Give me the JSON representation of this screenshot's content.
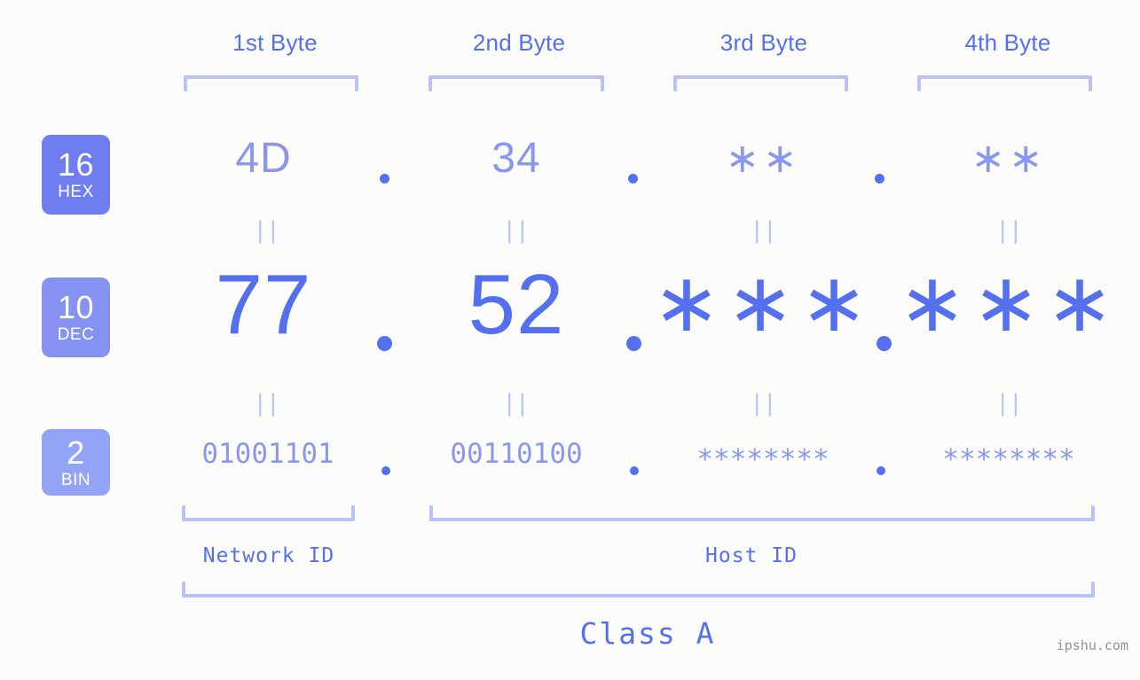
{
  "background_color": "#fcfdfa",
  "colors": {
    "strong_blue": "#5570ee",
    "light_blue": "#8b96ef",
    "pale_blue": "#b9c2f7",
    "badge_hex": "#6e7ef0",
    "badge_dec": "#8592f2",
    "badge_bin": "#93a3f6",
    "watermark_gray": "#8f9398"
  },
  "header": {
    "byte_labels": [
      {
        "text": "1st Byte"
      },
      {
        "text": "2nd Byte"
      },
      {
        "text": "3rd Byte"
      },
      {
        "text": "4th Byte"
      }
    ]
  },
  "bases": [
    {
      "num": "16",
      "name": "HEX"
    },
    {
      "num": "10",
      "name": "DEC"
    },
    {
      "num": "2",
      "name": "BIN"
    }
  ],
  "rows": {
    "hex": {
      "base_num": "16",
      "base_name": "HEX",
      "values": [
        "4D",
        "34",
        "∗∗",
        "∗∗"
      ],
      "separator": "."
    },
    "dec": {
      "base_num": "10",
      "base_name": "DEC",
      "values": [
        "77",
        "52",
        "∗∗∗",
        "∗∗∗"
      ],
      "separator": "."
    },
    "bin": {
      "base_num": "2",
      "base_name": "BIN",
      "values": [
        "01001101",
        "00110100",
        "∗∗∗∗∗∗∗∗",
        "∗∗∗∗∗∗∗∗"
      ],
      "separator": "."
    }
  },
  "equality_marks": {
    "glyph": "||",
    "count_per_gap": 4,
    "gaps": 2
  },
  "sections": {
    "network_id": "Network ID",
    "host_id": "Host ID",
    "class": "Class A"
  },
  "watermark": "ipshu.com"
}
